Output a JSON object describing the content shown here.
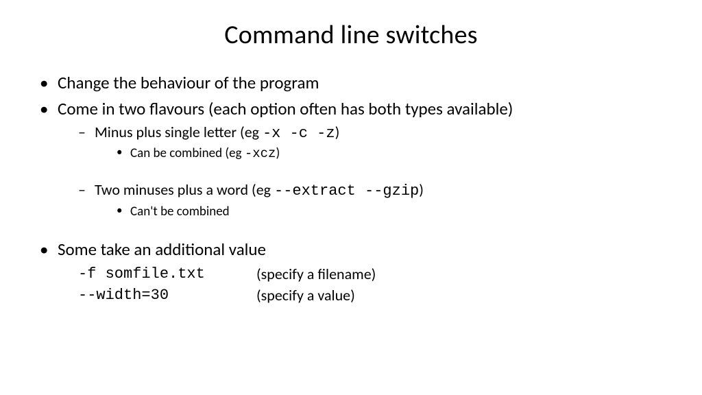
{
  "title": "Command line switches",
  "bullets": {
    "b1": "Change the behaviour of the program",
    "b2": "Come in two flavours (each option often has both types available)",
    "b2_1_pre": "Minus plus single letter (eg ",
    "b2_1_code": "-x -c -z",
    "b2_1_post": ")",
    "b2_1_1_pre": "Can be combined (eg ",
    "b2_1_1_code": "-xcz",
    "b2_1_1_post": ")",
    "b2_2_pre": "Two minuses plus a word (eg ",
    "b2_2_code": "--extract --gzip",
    "b2_2_post": ")",
    "b2_2_1": "Can't be combined",
    "b3": "Some take an additional value",
    "b3_row1_code": "-f somfile.txt",
    "b3_row1_desc": "(specify a filename)",
    "b3_row2_code": "--width=30",
    "b3_row2_desc": "(specify a value)"
  }
}
